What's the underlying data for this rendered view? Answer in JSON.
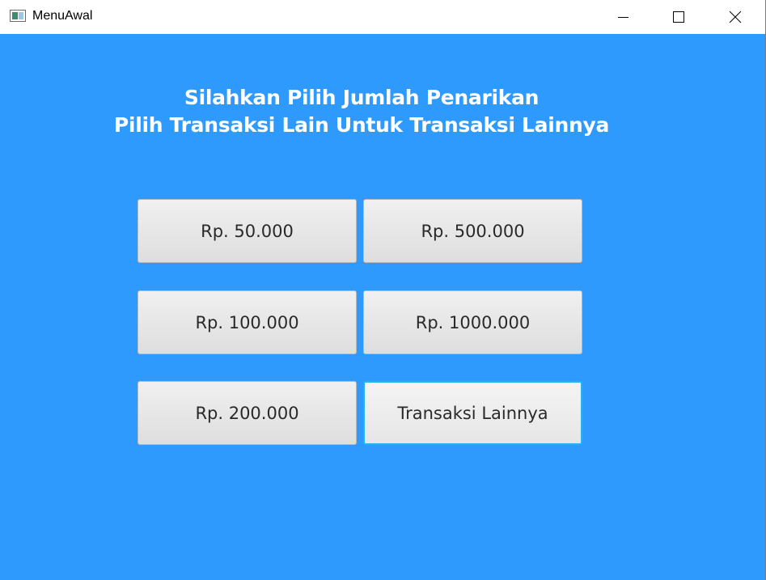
{
  "window": {
    "title": "MenuAwal",
    "icon": "java-app-window-icon",
    "controls": {
      "minimize": "minimize-icon",
      "maximize": "maximize-icon",
      "close": "close-icon"
    }
  },
  "main": {
    "background_color": "#2e9afe",
    "heading_line1": "Silahkan Pilih Jumlah Penarikan",
    "heading_line2": "Pilih Transaksi Lain Untuk Transaksi Lainnya",
    "buttons": [
      {
        "label": "Rp. 50.000"
      },
      {
        "label": "Rp. 500.000"
      },
      {
        "label": "Rp. 100.000"
      },
      {
        "label": "Rp. 1000.000"
      },
      {
        "label": "Rp. 200.000"
      },
      {
        "label": "Transaksi Lainnya",
        "focused": true
      }
    ]
  }
}
